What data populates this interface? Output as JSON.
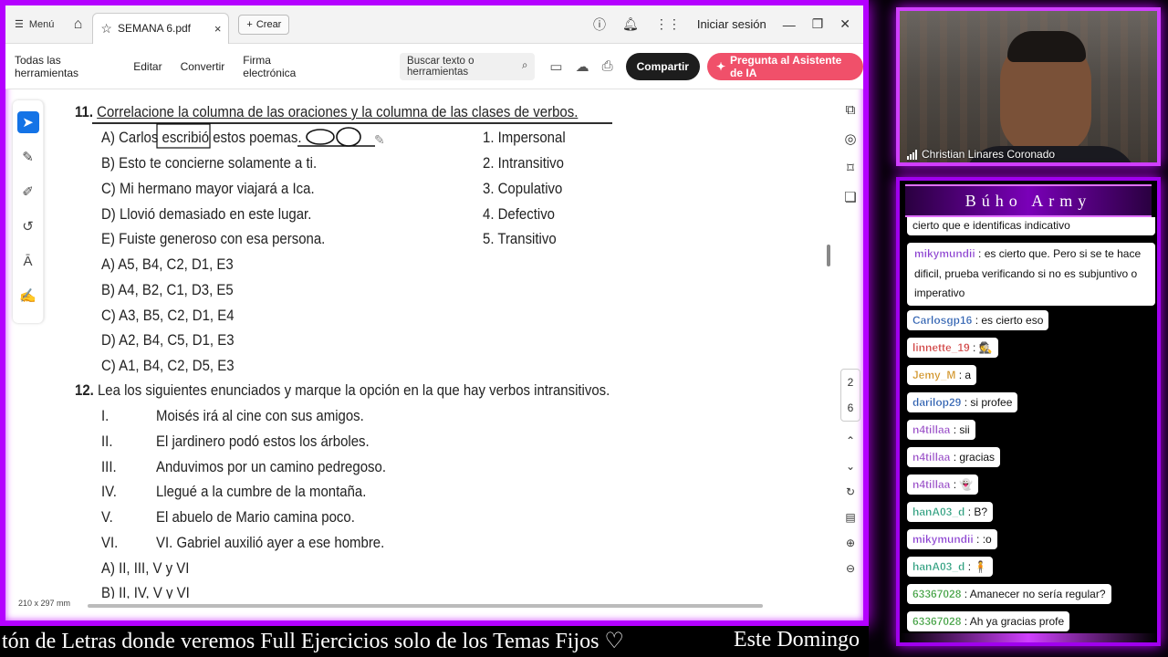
{
  "acrobat": {
    "menu_label": "Menú",
    "tab_title": "SEMANA 6.pdf",
    "crear_label": "Crear",
    "signin_label": "Iniciar sesión",
    "tools": [
      "Todas las herramientas",
      "Editar",
      "Convertir",
      "Firma electrónica"
    ],
    "search_placeholder": "Buscar texto o herramientas",
    "share_label": "Compartir",
    "ai_label": "Pregunta al Asistente de IA",
    "page_indicator": [
      "2",
      "6"
    ],
    "page_size": "210 x 297 mm"
  },
  "document": {
    "q11": {
      "number": "11.",
      "prompt": "Correlacione la columna de las oraciones y la columna de las clases de verbos.",
      "sentences": [
        "A) Carlos escribió estos poemas.",
        "B) Esto te concierne solamente a ti.",
        "C) Mi hermano mayor viajará a Ica.",
        "D) Llovió demasiado en este lugar.",
        "E) Fuiste generoso con esa persona."
      ],
      "classes": [
        "1. Impersonal",
        "2. Intransitivo",
        "3. Copulativo",
        "4. Defectivo",
        "5. Transitivo"
      ],
      "options": [
        "A) A5, B4, C2, D1, E3",
        "B) A4, B2, C1, D3, E5",
        "C) A3, B5, C2, D1, E4",
        "D) A2, B4, C5, D1, E3",
        "C) A1, B4, C2, D5, E3"
      ]
    },
    "q12": {
      "number": "12.",
      "prompt": "Lea los siguientes enunciados y marque la opción en la que hay verbos intransitivos.",
      "numerals": [
        "I.",
        "II.",
        "III.",
        "IV.",
        "V.",
        "VI."
      ],
      "statements": [
        "Moisés irá al cine con sus amigos.",
        "El jardinero podó estos los árboles.",
        "Anduvimos por un camino pedregoso.",
        "Llegué a la cumbre de la montaña.",
        "El abuelo de Mario camina poco.",
        "VI. Gabriel auxilió ayer a ese hombre."
      ],
      "options": [
        "A) II, III, V y VI",
        "B) II, IV, V y VI"
      ]
    }
  },
  "ticker": {
    "main": "tón de Letras donde veremos Full Ejercicios solo de los Temas Fijos ♡",
    "right": "Este Domingo"
  },
  "webcam": {
    "name": "Christian Linares Coronado"
  },
  "chat": {
    "title": "Búho Army",
    "messages": [
      {
        "user": "",
        "text": "cierto que e identificas indicativo",
        "color": "#333333"
      },
      {
        "user": "mikymundii",
        "text": ": es cierto que. Pero si se te hace dificil, prueba verificando si no es subjuntivo o imperativo",
        "color": "#8a3fd0"
      },
      {
        "user": "Carlosgp16",
        "text": ": es cierto eso",
        "color": "#2c5fb0"
      },
      {
        "user": "linnette_19",
        "text": ": 🕵",
        "color": "#d04040"
      },
      {
        "user": "Jemy_M",
        "text": ": a",
        "color": "#d09020"
      },
      {
        "user": "darilop29",
        "text": ": si profee",
        "color": "#2c5fb0"
      },
      {
        "user": "n4tillaa",
        "text": ": sii",
        "color": "#9a50c8"
      },
      {
        "user": "n4tillaa",
        "text": ": gracias",
        "color": "#9a50c8"
      },
      {
        "user": "n4tillaa",
        "text": ": 👻",
        "color": "#9a50c8"
      },
      {
        "user": "hanA03_d",
        "text": ": B?",
        "color": "#30a080"
      },
      {
        "user": "mikymundii",
        "text": ": :o",
        "color": "#8a3fd0"
      },
      {
        "user": "hanA03_d",
        "text": ": 🧍",
        "color": "#30a080"
      },
      {
        "user": "63367028",
        "text": ": Amanecer no sería regular?",
        "color": "#40a040"
      },
      {
        "user": "63367028",
        "text": ": Ah ya gracias profe",
        "color": "#40a040"
      }
    ]
  }
}
